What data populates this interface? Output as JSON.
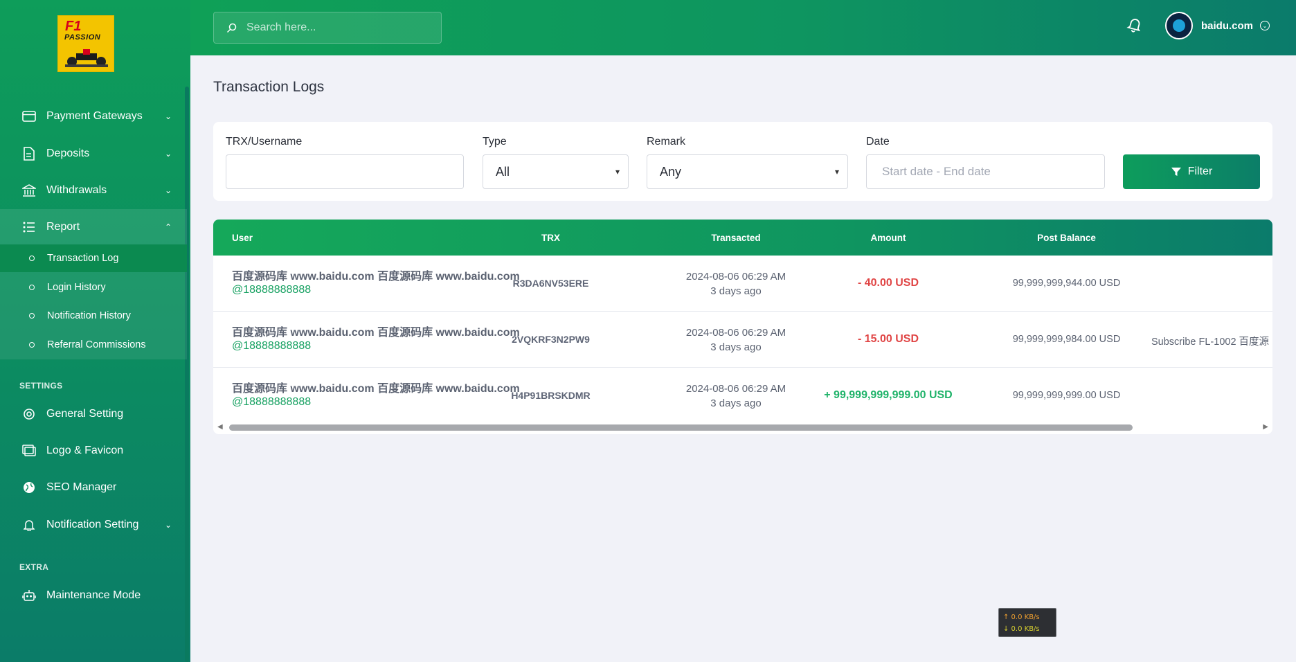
{
  "brand": {
    "logo_line1": "F1",
    "logo_line2": "PASSION"
  },
  "sidebar": {
    "items": [
      {
        "label": "Payment Gateways"
      },
      {
        "label": "Deposits"
      },
      {
        "label": "Withdrawals"
      },
      {
        "label": "Report"
      }
    ],
    "report_sub": [
      {
        "label": "Transaction Log"
      },
      {
        "label": "Login History"
      },
      {
        "label": "Notification History"
      },
      {
        "label": "Referral Commissions"
      }
    ],
    "settings_label": "SETTINGS",
    "settings_items": [
      {
        "label": "General Setting"
      },
      {
        "label": "Logo & Favicon"
      },
      {
        "label": "SEO Manager"
      },
      {
        "label": "Notification Setting"
      }
    ],
    "extra_label": "EXTRA",
    "extra_items": [
      {
        "label": "Maintenance Mode"
      }
    ]
  },
  "header": {
    "search_placeholder": "Search here...",
    "profile_name": "baidu.com"
  },
  "page": {
    "title": "Transaction Logs"
  },
  "filters": {
    "trx_label": "TRX/Username",
    "trx_value": "",
    "type_label": "Type",
    "type_value": "All",
    "remark_label": "Remark",
    "remark_value": "Any",
    "date_label": "Date",
    "date_placeholder": "Start date - End date",
    "filter_button": "Filter"
  },
  "table": {
    "headers": {
      "user": "User",
      "trx": "TRX",
      "transacted": "Transacted",
      "amount": "Amount",
      "post_balance": "Post Balance"
    },
    "rows": [
      {
        "user": "百度源码库 www.baidu.com 百度源码库 www.baidu.com",
        "handle": "@18888888888",
        "trx": "R3DA6NV53ERE",
        "date": "2024-08-06 06:29 AM",
        "ago": "3 days ago",
        "amount": "- 40.00 USD",
        "positive": false,
        "balance": "99,999,999,944.00 USD",
        "details": ""
      },
      {
        "user": "百度源码库 www.baidu.com 百度源码库 www.baidu.com",
        "handle": "@18888888888",
        "trx": "2VQKRF3N2PW9",
        "date": "2024-08-06 06:29 AM",
        "ago": "3 days ago",
        "amount": "- 15.00 USD",
        "positive": false,
        "balance": "99,999,999,984.00 USD",
        "details": "Subscribe FL-1002 百度源"
      },
      {
        "user": "百度源码库 www.baidu.com 百度源码库 www.baidu.com",
        "handle": "@18888888888",
        "trx": "H4P91BRSKDMR",
        "date": "2024-08-06 06:29 AM",
        "ago": "3 days ago",
        "amount": "+ 99,999,999,999.00 USD",
        "positive": true,
        "balance": "99,999,999,999.00 USD",
        "details": ""
      }
    ]
  },
  "netspeed": {
    "up": "↑ 0.0 KB/s",
    "down": "↓ 0.0 KB/s"
  },
  "colors": {
    "brand_green": "#0fa057",
    "brand_teal": "#0b7b6b",
    "negative": "#e04545",
    "positive": "#20b36a"
  }
}
